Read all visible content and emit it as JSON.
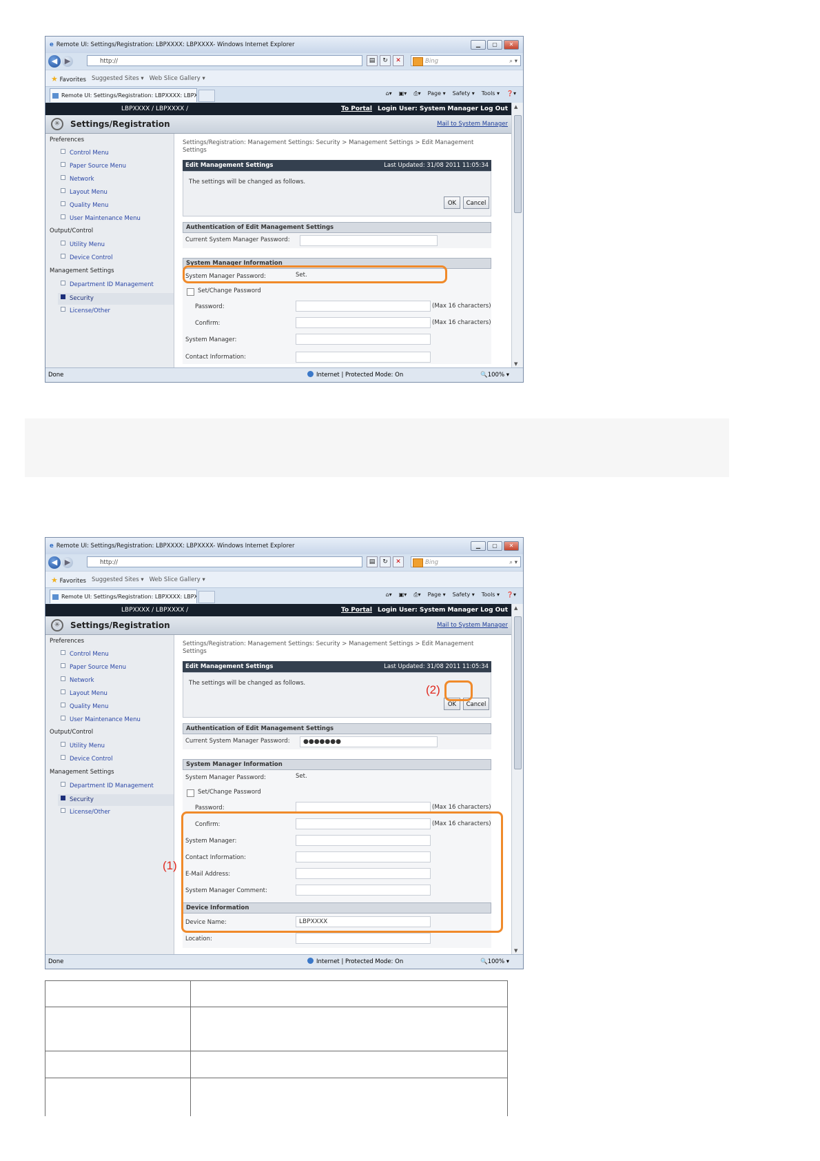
{
  "browser": {
    "title": "Remote UI: Settings/Registration: LBPXXXX: LBPXXXX- Windows Internet Explorer",
    "window_buttons": [
      "minimize-icon",
      "maximize-icon",
      "close-icon"
    ],
    "address": "http://",
    "search_placeholder": "Bing",
    "favorites": "Favorites",
    "suggested_sites": "Suggested Sites ▾",
    "web_slice_gallery": "Web Slice Gallery ▾",
    "tab_title": "Remote UI: Settings/Registration: LBPXXXX: LBPX...",
    "commands": [
      "Page ▾",
      "Safety ▾",
      "Tools ▾",
      "❓▾"
    ],
    "status_done": "Done",
    "status_zone": "Internet | Protected Mode: On",
    "status_zoom": "🔍100%  ▾"
  },
  "page": {
    "product": "LBPXXXX / LBPXXXX /",
    "to_portal": "To Portal",
    "login_user": "Login User: System Manager Log Out",
    "title": "Settings/Registration",
    "mail": "Mail to System Manager",
    "nav": {
      "preferences": "Preferences",
      "control_menu": "Control Menu",
      "paper_source_menu": "Paper Source Menu",
      "network": "Network",
      "layout_menu": "Layout Menu",
      "quality_menu": "Quality Menu",
      "user_maintenance_menu": "User Maintenance Menu",
      "output_control": "Output/Control",
      "utility_menu": "Utility Menu",
      "device_control": "Device Control",
      "management_settings": "Management Settings",
      "department_id": "Department ID Management",
      "security": "Security",
      "license_other": "License/Other"
    },
    "breadcrumb": "Settings/Registration: Management Settings: Security > Management Settings > Edit Management Settings",
    "section_title": "Edit Management Settings",
    "last_updated": "Last Updated: 31/08 2011 11:05:34",
    "message": "The settings will be changed as follows.",
    "ok": "OK",
    "cancel": "Cancel",
    "auth_header": "Authentication of Edit Management Settings",
    "current_password_label": "Current System Manager Password:",
    "current_password_value_2": "●●●●●●●",
    "sysinfo_header": "System Manager Information",
    "sm_password_label": "System Manager Password:",
    "sm_password_value": "Set.",
    "set_change_password": "Set/Change Password",
    "password_label": "Password:",
    "confirm_label": "Confirm:",
    "max_chars": "(Max 16 characters)",
    "system_manager_label": "System Manager:",
    "contact_label": "Contact Information:",
    "email_label": "E-Mail Address:",
    "comment_label": "System Manager Comment:",
    "device_header": "Device Information",
    "device_name_label": "Device Name:",
    "device_name_value": "LBPXXXX",
    "location_label": "Location:"
  },
  "callouts": {
    "one": "(1)",
    "two": "(2)"
  },
  "colors": {
    "highlight": "#f08a2a",
    "callout": "#e0281e",
    "header_dark": "#17202c"
  }
}
